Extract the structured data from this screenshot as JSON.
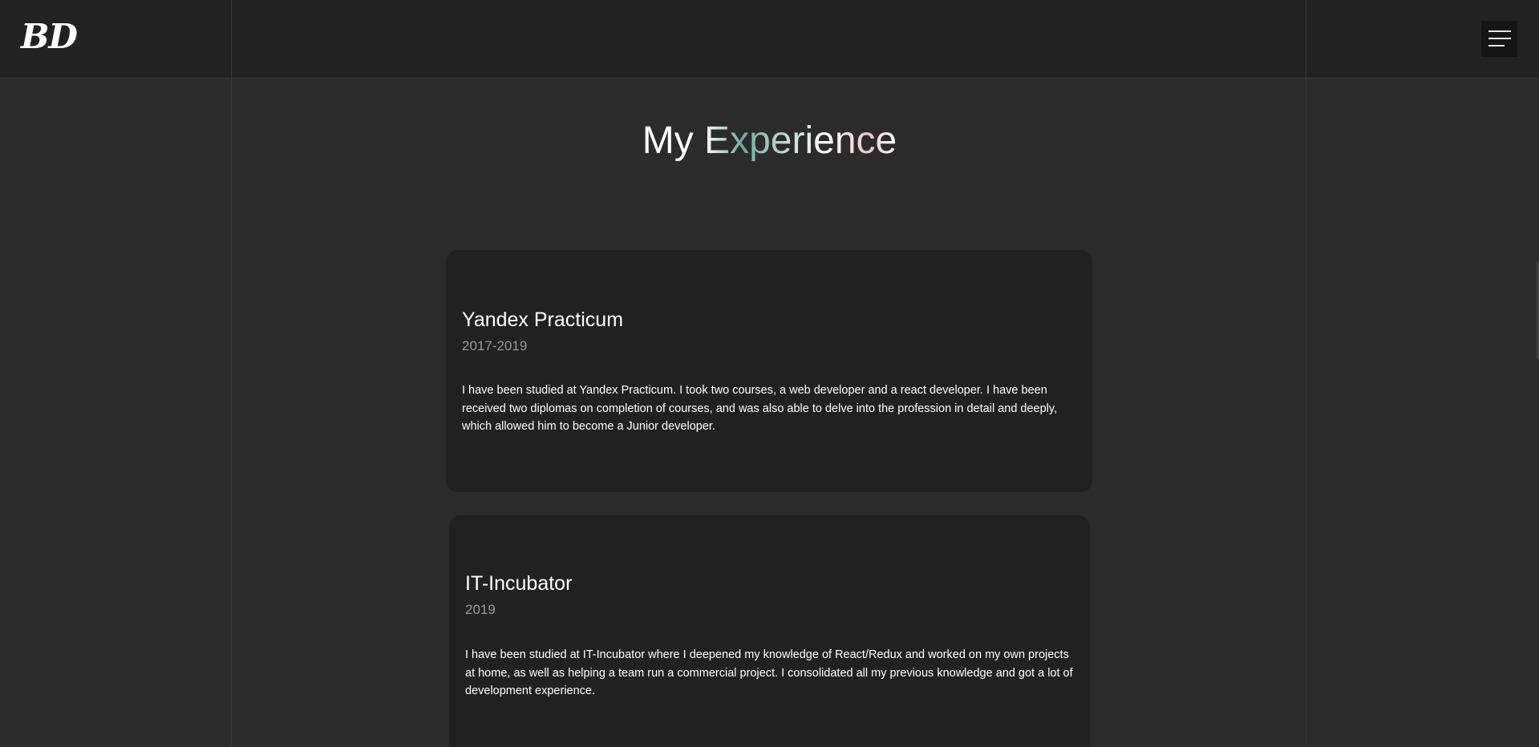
{
  "header": {
    "logo": "BD",
    "menu_icon": "hamburger-menu-icon"
  },
  "section": {
    "title_prefix": "My",
    "title_accent": "Experience"
  },
  "experience": [
    {
      "title": "Yandex Practicum",
      "years": "2017-2019",
      "description": "I have been studied at Yandex Practicum. I took two courses, a web developer and a react developer. I have been received two diplomas on completion of courses, and was also able to delve into the profession in detail and deeply, which allowed him to become a Junior developer."
    },
    {
      "title": "IT-Incubator",
      "years": "2019",
      "description": "I have been studied at IT-Incubator where I deepened my knowledge of React/Redux and worked on my own projects at home, as well as helping a team run a commercial project. I consolidated all my previous knowledge and got a lot of development experience."
    }
  ],
  "colors": {
    "background": "#2b2b2b",
    "header": "#222222",
    "card": "#212121",
    "text": "#ffffff",
    "muted": "#9a9a9a"
  }
}
